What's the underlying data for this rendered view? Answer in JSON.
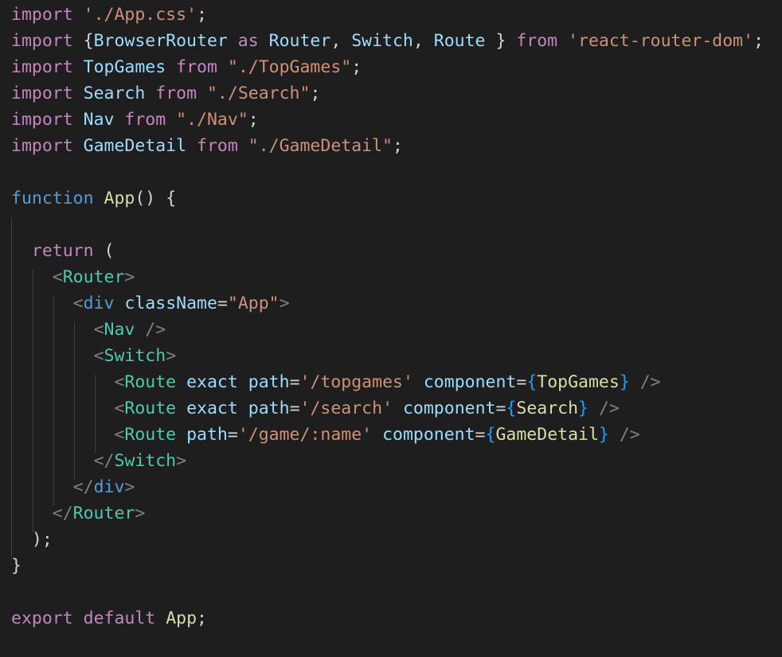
{
  "theme": {
    "background": "#1e1e1e",
    "keyword_purple": "#c586c0",
    "keyword_blue": "#569cd6",
    "string": "#ce9178",
    "identifier": "#9cdcfe",
    "function": "#dcdcaa",
    "component": "#4ec9b0",
    "punctuation": "#d4d4d4",
    "bracket_gray": "#808080",
    "brace_yellow": "#ffd700",
    "brace_blue": "#179fff",
    "indent_guide": "#404040"
  },
  "code": {
    "lines": [
      [
        [
          "import",
          "kw"
        ],
        [
          " ",
          "p"
        ],
        [
          "'./App.css'",
          "str"
        ],
        [
          ";",
          "p"
        ]
      ],
      [
        [
          "import",
          "kw"
        ],
        [
          " {",
          "p"
        ],
        [
          "BrowserRouter",
          "id"
        ],
        [
          " ",
          "p"
        ],
        [
          "as",
          "kw"
        ],
        [
          " ",
          "p"
        ],
        [
          "Router",
          "id"
        ],
        [
          ", ",
          "p"
        ],
        [
          "Switch",
          "id"
        ],
        [
          ", ",
          "p"
        ],
        [
          "Route",
          "id"
        ],
        [
          " } ",
          "p"
        ],
        [
          "from",
          "kw"
        ],
        [
          " ",
          "p"
        ],
        [
          "'react-router-dom'",
          "str"
        ],
        [
          ";",
          "p"
        ]
      ],
      [
        [
          "import",
          "kw"
        ],
        [
          " ",
          "p"
        ],
        [
          "TopGames",
          "id"
        ],
        [
          " ",
          "p"
        ],
        [
          "from",
          "kw"
        ],
        [
          " ",
          "p"
        ],
        [
          "\"./TopGames\"",
          "str"
        ],
        [
          ";",
          "p"
        ]
      ],
      [
        [
          "import",
          "kw"
        ],
        [
          " ",
          "p"
        ],
        [
          "Search",
          "id"
        ],
        [
          " ",
          "p"
        ],
        [
          "from",
          "kw"
        ],
        [
          " ",
          "p"
        ],
        [
          "\"./Search\"",
          "str"
        ],
        [
          ";",
          "p"
        ]
      ],
      [
        [
          "import",
          "kw"
        ],
        [
          " ",
          "p"
        ],
        [
          "Nav",
          "id"
        ],
        [
          " ",
          "p"
        ],
        [
          "from",
          "kw"
        ],
        [
          " ",
          "p"
        ],
        [
          "\"./Nav\"",
          "str"
        ],
        [
          ";",
          "p"
        ]
      ],
      [
        [
          "import",
          "kw"
        ],
        [
          " ",
          "p"
        ],
        [
          "GameDetail",
          "id"
        ],
        [
          " ",
          "p"
        ],
        [
          "from",
          "kw"
        ],
        [
          " ",
          "p"
        ],
        [
          "\"./GameDetail\"",
          "str"
        ],
        [
          ";",
          "p"
        ]
      ],
      [],
      [
        [
          "function",
          "kw2"
        ],
        [
          " ",
          "p"
        ],
        [
          "App",
          "fn"
        ],
        [
          "() {",
          "p"
        ]
      ],
      [],
      [
        [
          "  ",
          "p"
        ],
        [
          "return",
          "kw"
        ],
        [
          " (",
          "p"
        ]
      ],
      [
        [
          "    ",
          "p"
        ],
        [
          "<",
          "br"
        ],
        [
          "Router",
          "comp"
        ],
        [
          ">",
          "br"
        ]
      ],
      [
        [
          "      ",
          "p"
        ],
        [
          "<",
          "br"
        ],
        [
          "div",
          "kw2"
        ],
        [
          " ",
          "p"
        ],
        [
          "className",
          "id"
        ],
        [
          "=",
          "p"
        ],
        [
          "\"App\"",
          "str"
        ],
        [
          ">",
          "br"
        ]
      ],
      [
        [
          "        ",
          "p"
        ],
        [
          "<",
          "br"
        ],
        [
          "Nav",
          "comp"
        ],
        [
          " />",
          "br"
        ]
      ],
      [
        [
          "        ",
          "p"
        ],
        [
          "<",
          "br"
        ],
        [
          "Switch",
          "comp"
        ],
        [
          ">",
          "br"
        ]
      ],
      [
        [
          "          ",
          "p"
        ],
        [
          "<",
          "br"
        ],
        [
          "Route",
          "comp"
        ],
        [
          " ",
          "p"
        ],
        [
          "exact",
          "id"
        ],
        [
          " ",
          "p"
        ],
        [
          "path",
          "id"
        ],
        [
          "=",
          "p"
        ],
        [
          "'/topgames'",
          "str"
        ],
        [
          " ",
          "p"
        ],
        [
          "component",
          "id"
        ],
        [
          "=",
          "p"
        ],
        [
          "{",
          "bb"
        ],
        [
          "TopGames",
          "fn"
        ],
        [
          "}",
          "bb"
        ],
        [
          " />",
          "br"
        ]
      ],
      [
        [
          "          ",
          "p"
        ],
        [
          "<",
          "br"
        ],
        [
          "Route",
          "comp"
        ],
        [
          " ",
          "p"
        ],
        [
          "exact",
          "id"
        ],
        [
          " ",
          "p"
        ],
        [
          "path",
          "id"
        ],
        [
          "=",
          "p"
        ],
        [
          "'/search'",
          "str"
        ],
        [
          " ",
          "p"
        ],
        [
          "component",
          "id"
        ],
        [
          "=",
          "p"
        ],
        [
          "{",
          "bb"
        ],
        [
          "Search",
          "fn"
        ],
        [
          "}",
          "bb"
        ],
        [
          " />",
          "br"
        ]
      ],
      [
        [
          "          ",
          "p"
        ],
        [
          "<",
          "br"
        ],
        [
          "Route",
          "comp"
        ],
        [
          " ",
          "p"
        ],
        [
          "path",
          "id"
        ],
        [
          "=",
          "p"
        ],
        [
          "'/game/:name'",
          "str"
        ],
        [
          " ",
          "p"
        ],
        [
          "component",
          "id"
        ],
        [
          "=",
          "p"
        ],
        [
          "{",
          "bb"
        ],
        [
          "GameDetail",
          "fn"
        ],
        [
          "}",
          "bb"
        ],
        [
          " />",
          "br"
        ]
      ],
      [
        [
          "        ",
          "p"
        ],
        [
          "</",
          "br"
        ],
        [
          "Switch",
          "comp"
        ],
        [
          ">",
          "br"
        ]
      ],
      [
        [
          "      ",
          "p"
        ],
        [
          "</",
          "br"
        ],
        [
          "div",
          "kw2"
        ],
        [
          ">",
          "br"
        ]
      ],
      [
        [
          "    ",
          "p"
        ],
        [
          "</",
          "br"
        ],
        [
          "Router",
          "comp"
        ],
        [
          ">",
          "br"
        ]
      ],
      [
        [
          "  );",
          "p"
        ]
      ],
      [
        [
          "}",
          "p"
        ]
      ],
      [],
      [
        [
          "export",
          "kw"
        ],
        [
          " ",
          "p"
        ],
        [
          "default",
          "kw"
        ],
        [
          " ",
          "p"
        ],
        [
          "App",
          "fn"
        ],
        [
          ";",
          "p"
        ]
      ]
    ]
  }
}
